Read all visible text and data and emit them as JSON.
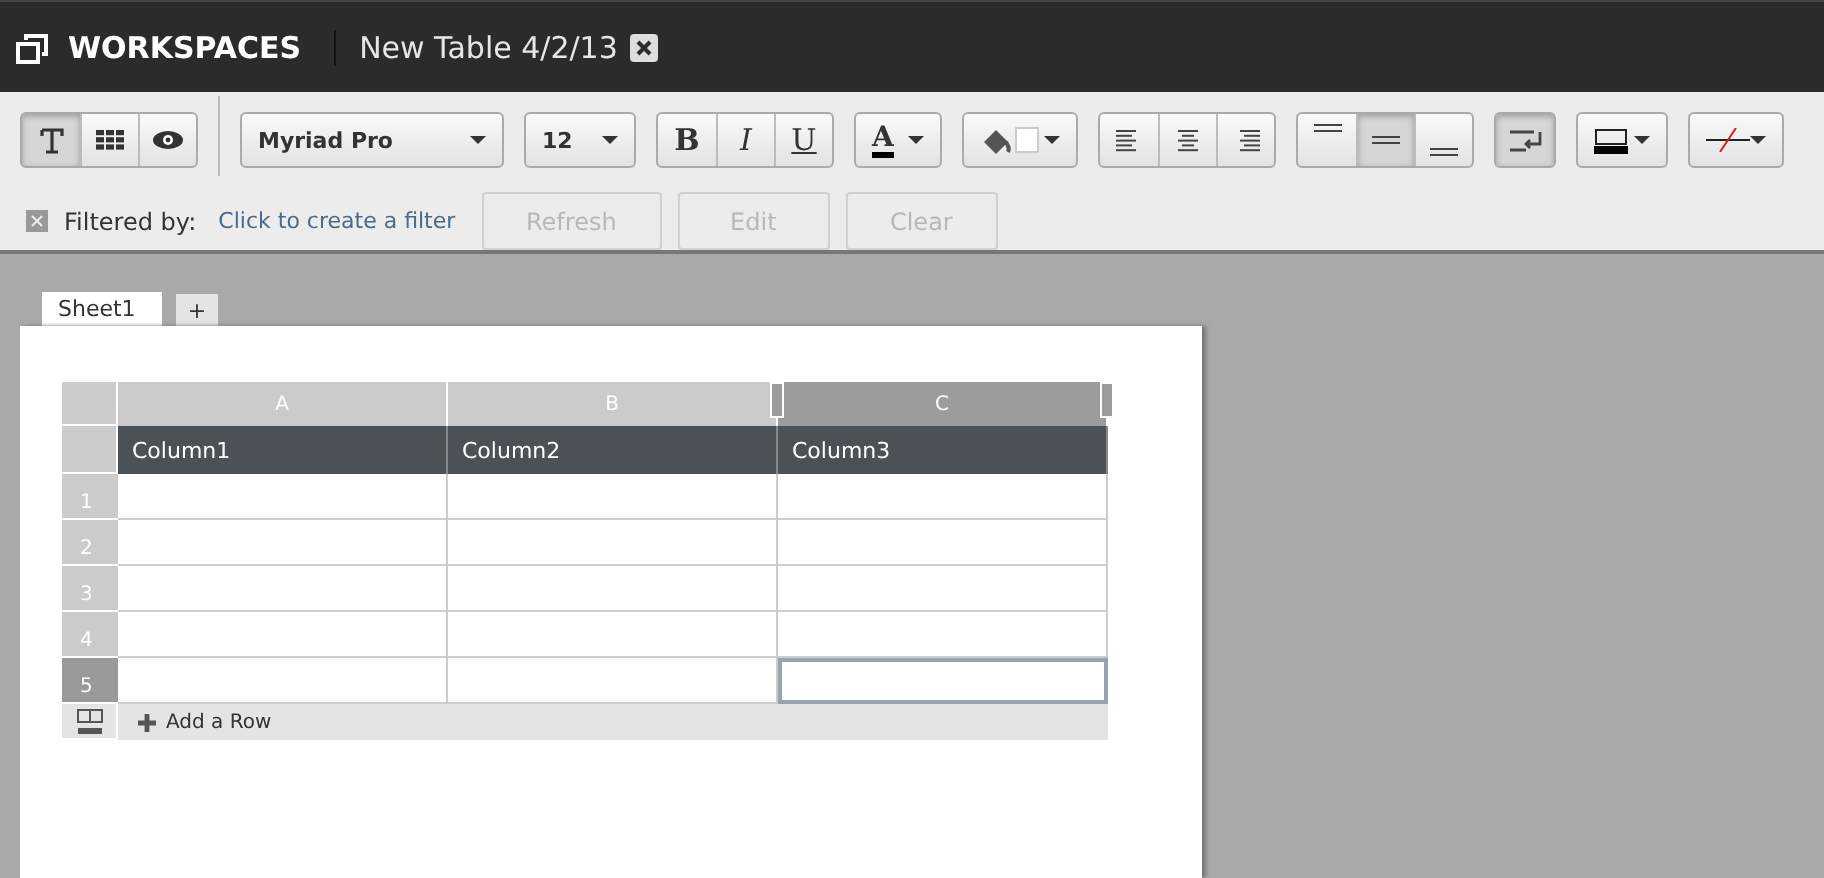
{
  "header": {
    "title": "WORKSPACES",
    "document": "New Table 4/2/13"
  },
  "toolbar": {
    "view_modes": [
      {
        "kind": "text",
        "selected": true
      },
      {
        "kind": "grid",
        "selected": false
      },
      {
        "kind": "preview",
        "selected": false
      }
    ],
    "font": "Myriad Pro",
    "size": "12",
    "styles": [
      {
        "kind": "bold",
        "label": "B",
        "on": false
      },
      {
        "kind": "italic",
        "label": "I",
        "on": false
      },
      {
        "kind": "underline",
        "label": "U",
        "on": false
      }
    ],
    "text_color_label": "A",
    "horizontal_align": [
      {
        "kind": "left",
        "selected": false
      },
      {
        "kind": "center",
        "selected": false
      },
      {
        "kind": "right",
        "selected": false
      }
    ],
    "vertical_align": [
      {
        "kind": "top",
        "selected": false
      },
      {
        "kind": "middle",
        "selected": true
      },
      {
        "kind": "bottom",
        "selected": false
      }
    ],
    "wrap": {
      "on": true
    }
  },
  "filter": {
    "label": "Filtered by:",
    "link": "Click to create a filter",
    "buttons": [
      {
        "label": "Refresh",
        "disabled": true
      },
      {
        "label": "Edit",
        "disabled": true
      },
      {
        "label": "Clear",
        "disabled": true
      }
    ]
  },
  "sheet_tabs": [
    {
      "label": "Sheet1",
      "selected": true
    },
    {
      "label": "+",
      "selected": false
    }
  ],
  "table": {
    "columns": [
      {
        "letter": "A",
        "name": "Column1",
        "selected": false
      },
      {
        "letter": "B",
        "name": "Column2",
        "selected": false
      },
      {
        "letter": "C",
        "name": "Column3",
        "selected": true
      }
    ],
    "rows": [
      {
        "label": "1",
        "selected": false
      },
      {
        "label": "2",
        "selected": false
      },
      {
        "label": "3",
        "selected": false
      },
      {
        "label": "4",
        "selected": false
      },
      {
        "label": "5",
        "selected": true
      }
    ],
    "add_row": "Add a Row"
  }
}
